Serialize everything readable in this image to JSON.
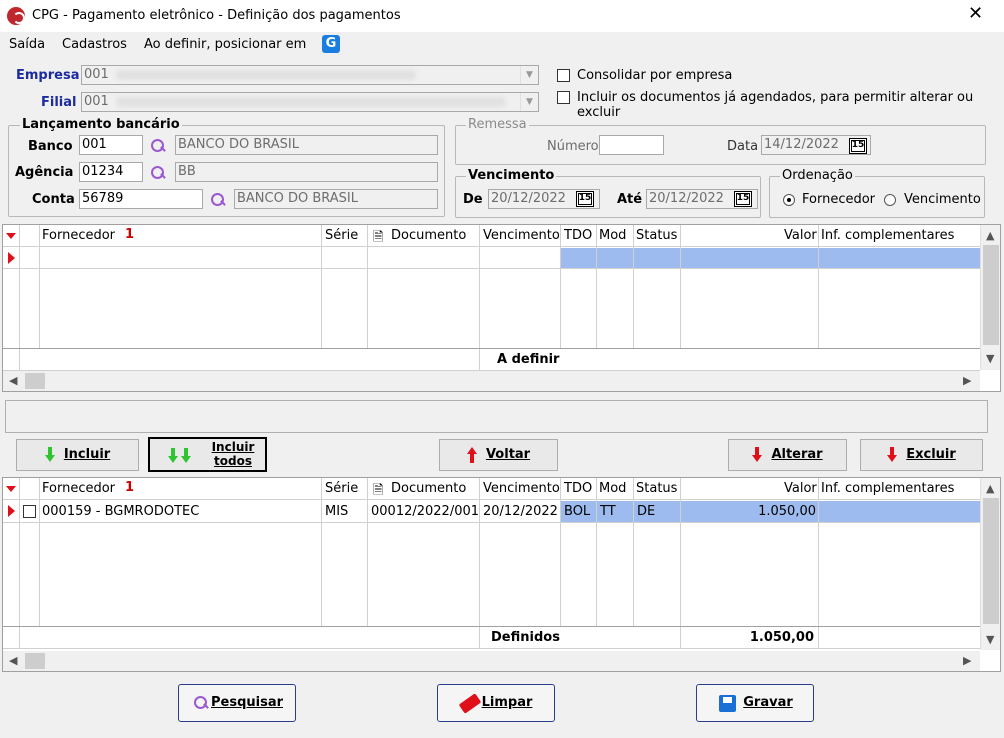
{
  "window": {
    "title": "CPG - Pagamento eletrônico - Definição dos pagamentos",
    "close": "✕"
  },
  "menu": [
    "Saída",
    "Cadastros",
    "Ao definir, posicionar em"
  ],
  "form": {
    "empresa_label": "Empresa",
    "empresa_value": "001",
    "filial_label": "Filial",
    "filial_value": "001",
    "consolidar_label": "Consolidar por empresa",
    "incluir_docs_label": "Incluir os documentos já agendados, para permitir alterar ou excluir"
  },
  "lancamento": {
    "title": "Lançamento bancário",
    "banco_label": "Banco",
    "banco_value": "001",
    "banco_desc": "BANCO DO BRASIL",
    "agencia_label": "Agência",
    "agencia_value": "01234",
    "agencia_desc": "BB",
    "conta_label": "Conta",
    "conta_value": "56789",
    "conta_desc": "BANCO DO BRASIL"
  },
  "remessa": {
    "title": "Remessa",
    "numero_label": "Número",
    "numero_value": "",
    "data_label": "Data",
    "data_value": "14/12/2022",
    "cal": "15"
  },
  "vencimento": {
    "title": "Vencimento",
    "de_label": "De",
    "de_value": "20/12/2022",
    "ate_label": "Até",
    "ate_value": "20/12/2022"
  },
  "ordenacao": {
    "title": "Ordenação",
    "fornecedor": "Fornecedor",
    "vencimento": "Vencimento",
    "selected": "Fornecedor"
  },
  "columns": {
    "fornecedor": "Fornecedor",
    "sort": "1",
    "serie": "Série",
    "documento": "Documento",
    "vencimento": "Vencimento",
    "tdo": "TDO",
    "mod": "Mod",
    "status": "Status",
    "valor": "Valor",
    "inf": "Inf. complementares"
  },
  "grid1": {
    "footer": "A definir"
  },
  "buttons": {
    "incluir": "Incluir",
    "incluir_todos": "Incluir todos",
    "voltar": "Voltar",
    "alterar": "Alterar",
    "excluir": "Excluir",
    "pesquisar": "Pesquisar",
    "limpar": "Limpar",
    "gravar": "Gravar"
  },
  "grid2": {
    "rows": [
      {
        "fornecedor": "000159 - BGMRODOTEC",
        "serie": "MIS",
        "documento": "00012/2022/001",
        "vencimento": "20/12/2022",
        "tdo": "BOL",
        "mod": "TT",
        "status": "DE",
        "valor": "1.050,00",
        "inf": ""
      }
    ],
    "footer_label": "Definidos",
    "footer_total": "1.050,00"
  },
  "colors": {
    "selection": "#9ebbef",
    "accent": "#1c2b9e",
    "red": "#e0101b"
  }
}
